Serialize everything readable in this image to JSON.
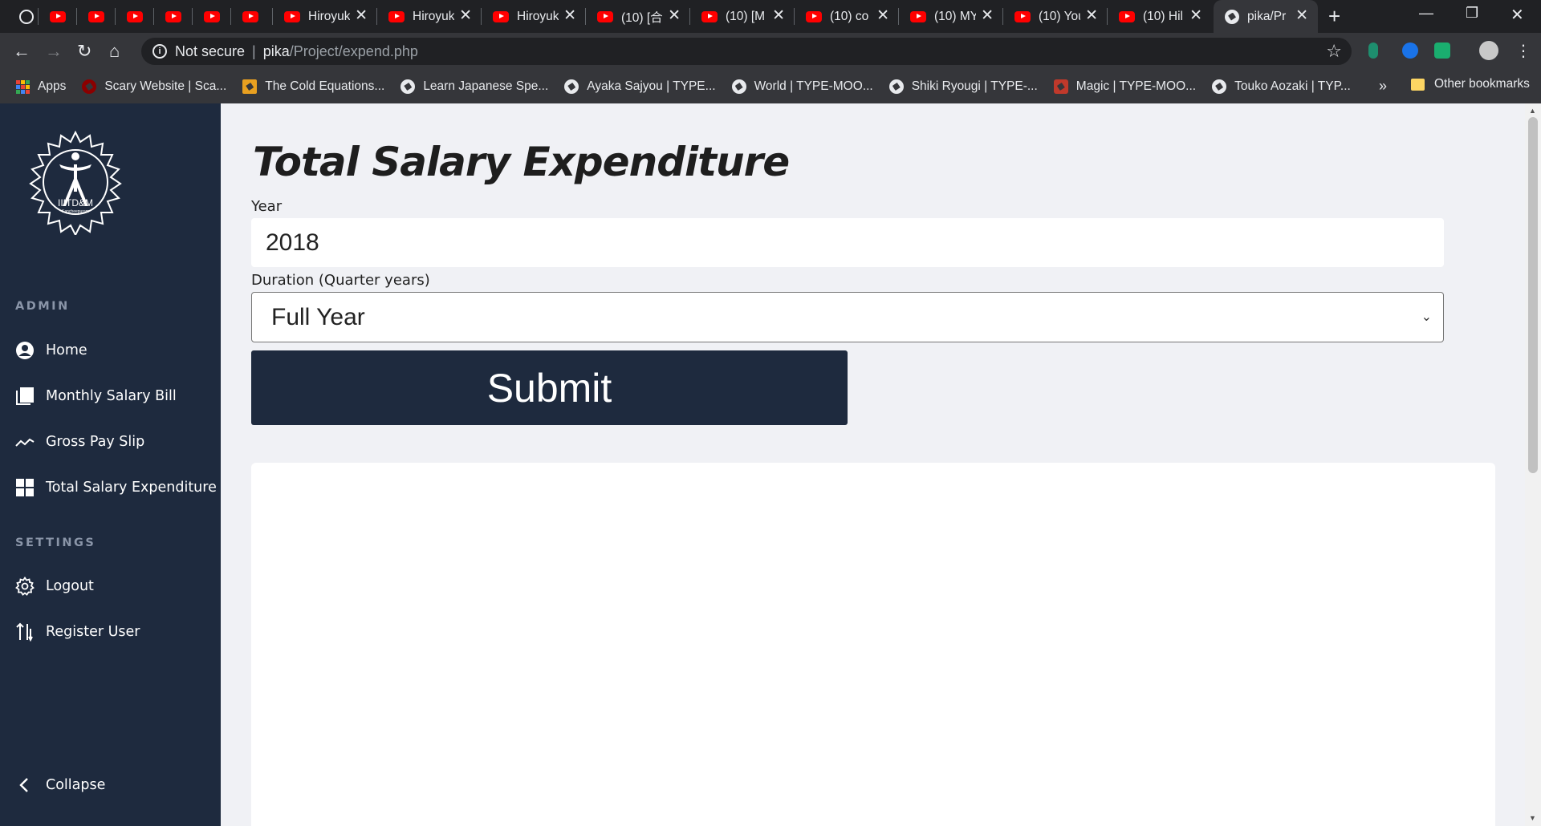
{
  "browser": {
    "tabs": [
      {
        "title": ""
      },
      {
        "title": ""
      },
      {
        "title": ""
      },
      {
        "title": ""
      },
      {
        "title": ""
      },
      {
        "title": ""
      },
      {
        "title": "Hiroyuk"
      },
      {
        "title": "Hiroyuk"
      },
      {
        "title": "Hiroyuk"
      },
      {
        "title": "(10) [合"
      },
      {
        "title": "(10) [M"
      },
      {
        "title": "(10) co"
      },
      {
        "title": "(10) MY"
      },
      {
        "title": "(10) You"
      },
      {
        "title": "(10) Hil"
      },
      {
        "title": "pika/Pr"
      }
    ],
    "omnibox": {
      "security_label": "Not secure",
      "divider": "|",
      "host": "pika",
      "path": "/Project/expend.php"
    },
    "bookmarks": [
      {
        "label": "Apps"
      },
      {
        "label": "Scary Website | Sca..."
      },
      {
        "label": "The Cold Equations..."
      },
      {
        "label": "Learn Japanese Spe..."
      },
      {
        "label": "Ayaka Sajyou | TYPE..."
      },
      {
        "label": "World | TYPE-MOO..."
      },
      {
        "label": "Shiki Ryougi | TYPE-..."
      },
      {
        "label": "Magic | TYPE-MOO..."
      },
      {
        "label": "Touko Aozaki | TYP..."
      }
    ],
    "bookmarks_more": "»",
    "other_bookmarks": "Other bookmarks"
  },
  "sidebar": {
    "logo_text": "IIITD&M",
    "logo_subtext": "Kancheepuram",
    "admin_heading": "ADMIN",
    "admin_items": [
      {
        "label": "Home",
        "icon": "user-circle-icon"
      },
      {
        "label": "Monthly Salary Bill",
        "icon": "documents-icon"
      },
      {
        "label": "Gross Pay Slip",
        "icon": "trend-line-icon"
      },
      {
        "label": "Total Salary Expenditure",
        "icon": "grid-icon"
      }
    ],
    "settings_heading": "SETTINGS",
    "settings_items": [
      {
        "label": "Logout",
        "icon": "gear-icon"
      },
      {
        "label": "Register User",
        "icon": "sort-arrows-icon"
      }
    ],
    "collapse_label": "Collapse"
  },
  "main": {
    "title": "Total Salary Expenditure",
    "year_label": "Year",
    "year_value": "2018",
    "duration_label": "Duration (Quarter years)",
    "duration_value": "Full Year",
    "submit_label": "Submit"
  },
  "colors": {
    "sidebar_bg": "#1e2a3e",
    "page_bg": "#f0f1f5",
    "submit_bg": "#1e2a3e"
  }
}
